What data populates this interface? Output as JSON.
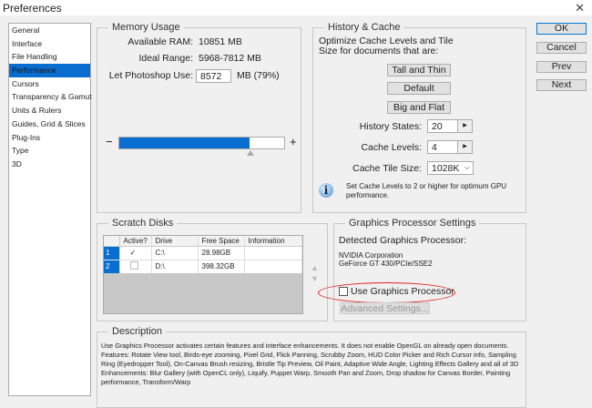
{
  "window": {
    "title": "Preferences",
    "close": "✕"
  },
  "sidebar": {
    "items": [
      {
        "label": "General"
      },
      {
        "label": "Interface"
      },
      {
        "label": "File Handling"
      },
      {
        "label": "Performance",
        "selected": true
      },
      {
        "label": "Cursors"
      },
      {
        "label": "Transparency & Gamut"
      },
      {
        "label": "Units & Rulers"
      },
      {
        "label": "Guides, Grid & Slices"
      },
      {
        "label": "Plug-Ins"
      },
      {
        "label": "Type"
      },
      {
        "label": "3D"
      }
    ]
  },
  "memory": {
    "title": "Memory Usage",
    "available_label": "Available RAM:",
    "available_value": "10851 MB",
    "ideal_label": "Ideal Range:",
    "ideal_value": "5968-7812 MB",
    "use_label": "Let Photoshop Use:",
    "use_value": "8572",
    "use_suffix": "MB (79%)",
    "minus": "−",
    "plus": "+",
    "slider_percent": 79
  },
  "history": {
    "title": "History & Cache",
    "intro": "Optimize Cache Levels and Tile Size for documents that are:",
    "btn_tall": "Tall and Thin",
    "btn_default": "Default",
    "btn_big": "Big and Flat",
    "states_label": "History States:",
    "states_value": "20",
    "levels_label": "Cache Levels:",
    "levels_value": "4",
    "tile_label": "Cache Tile Size:",
    "tile_value": "1028K",
    "info": "Set Cache Levels to 2 or higher for optimum GPU performance."
  },
  "buttons": {
    "ok": "OK",
    "cancel": "Cancel",
    "prev": "Prev",
    "next": "Next"
  },
  "scratch": {
    "title": "Scratch Disks",
    "headers": [
      "Active?",
      "Drive",
      "Free Space",
      "Information"
    ],
    "rows": [
      {
        "num": "1",
        "active": "✓",
        "drive": "C:\\",
        "free": "28.98GB",
        "info": ""
      },
      {
        "num": "2",
        "active": "",
        "drive": "D:\\",
        "free": "398.32GB",
        "info": ""
      }
    ]
  },
  "gpu": {
    "title": "Graphics Processor Settings",
    "detected_label": "Detected Graphics Processor:",
    "vendor": "NVIDIA Corporation",
    "model": "GeForce GT 430/PCIe/SSE2",
    "use_label": "Use Graphics Processor",
    "use_checked": false,
    "advanced": "Advanced Settings..."
  },
  "description": {
    "title": "Description",
    "text": "Use Graphics Processor activates certain features and interface enhancements. It does not enable OpenGL on already open documents.\nFeatures: Rotate View tool, Birds-eye zooming, Pixel Grid, Flick Panning, Scrubby Zoom, HUD Color Picker and Rich Cursor info, Sampling Ring (Eyedropper Tool), On-Canvas Brush resizing, Bristle Tip Preview, Oil Paint, Adaptive Wide Angle, Lighting Effects Gallery and all of 3D\nEnhancements: Blur Gallery (with OpenCL only), Liquify, Puppet Warp, Smooth Pan and Zoom, Drop shadow for Canvas Border, Painting performance, Transform/Warp"
  },
  "colors": {
    "accent": "#0a6ed1",
    "highlight": "#e02020"
  }
}
